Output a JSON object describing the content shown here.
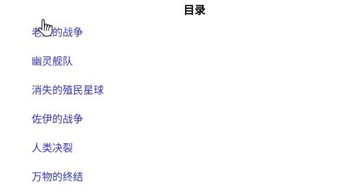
{
  "toc": {
    "title": "目录",
    "items": [
      {
        "label": "老人的战争"
      },
      {
        "label": "幽灵舰队"
      },
      {
        "label": "消失的殖民星球"
      },
      {
        "label": "佐伊的战争"
      },
      {
        "label": "人类决裂"
      },
      {
        "label": "万物的终结"
      }
    ]
  },
  "colors": {
    "link": "#3333cc",
    "title": "#000000",
    "background": "#ffffff"
  },
  "cursor": {
    "icon": "hand-pointer-icon"
  }
}
